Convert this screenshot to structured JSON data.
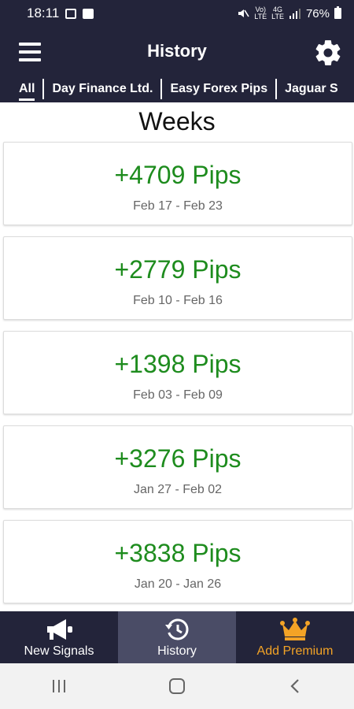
{
  "status": {
    "time": "18:11",
    "volte_line1": "Vo)",
    "volte_line2": "LTE",
    "net_line1": "4G",
    "net_line2": "LTE",
    "battery": "76%"
  },
  "header": {
    "title": "History",
    "menu_icon": "hamburger-menu-icon",
    "settings_icon": "gear-icon"
  },
  "tabs": [
    {
      "label": "All",
      "active": true
    },
    {
      "label": "Day Finance Ltd."
    },
    {
      "label": "Easy Forex Pips"
    },
    {
      "label": "Jaguar S"
    }
  ],
  "main": {
    "section_title": "Weeks",
    "weeks": [
      {
        "pips": "+4709 Pips",
        "range": "Feb 17 - Feb 23"
      },
      {
        "pips": "+2779 Pips",
        "range": "Feb 10 - Feb 16"
      },
      {
        "pips": "+1398 Pips",
        "range": "Feb 03 - Feb 09"
      },
      {
        "pips": "+3276 Pips",
        "range": "Jan 27 - Feb 02"
      },
      {
        "pips": "+3838 Pips",
        "range": "Jan 20 - Jan 26"
      }
    ]
  },
  "bottom_nav": {
    "items": [
      {
        "label": "New Signals",
        "icon": "megaphone-icon"
      },
      {
        "label": "History",
        "icon": "history-icon",
        "active": true
      },
      {
        "label": "Add Premium",
        "icon": "crown-icon"
      }
    ]
  },
  "colors": {
    "header_bg": "#23243a",
    "active_nav_bg": "#4a4c66",
    "pips_green": "#1e8c1e",
    "premium_orange": "#f3a326"
  }
}
